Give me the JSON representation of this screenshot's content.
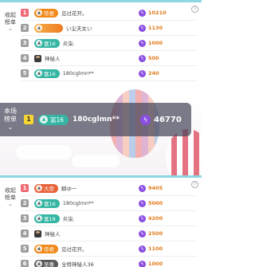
{
  "top_board": {
    "side_label_line1": "收起",
    "side_label_line2": "榜单",
    "chevron": "⌃",
    "rows": [
      {
        "rank": "1",
        "badge": "帝君",
        "badge_color": "orange",
        "name": "见过花开。",
        "score": "10210",
        "avatar": false
      },
      {
        "rank": "2",
        "badge": "",
        "badge_color": "flame",
        "name": "い尘夫女い",
        "score": "1130",
        "avatar": false
      },
      {
        "rank": "3",
        "badge": "富16",
        "badge_color": "teal",
        "name": "炎柒.",
        "score": "1000",
        "avatar": false
      },
      {
        "rank": "4",
        "badge": "",
        "badge_color": "",
        "name": "神秘人",
        "score": "500",
        "avatar": true
      },
      {
        "rank": "5",
        "badge": "富16",
        "badge_color": "teal",
        "name": "180cglmn**",
        "score": "240",
        "avatar": false
      }
    ]
  },
  "live_banner": {
    "title_line1": "本场",
    "title_line2": "榜单",
    "chevron": "⌄",
    "rank": "1",
    "badge": "富16",
    "name": "180cglmn**",
    "score": "46770"
  },
  "bottom_board": {
    "side_label_line1": "收起",
    "side_label_line2": "榜单",
    "chevron": "⌃",
    "rows": [
      {
        "rank": "1",
        "badge": "大帝",
        "badge_color": "red",
        "name": "瞬ゆ一",
        "score": "9405",
        "avatar": false
      },
      {
        "rank": "2",
        "badge": "富16",
        "badge_color": "teal",
        "name": "180cglmn**",
        "score": "5000",
        "avatar": false
      },
      {
        "rank": "3",
        "badge": "富18",
        "badge_color": "teal",
        "name": "炎柒.",
        "score": "4200",
        "avatar": false
      },
      {
        "rank": "4",
        "badge": "",
        "badge_color": "",
        "name": "神秘人",
        "score": "2500",
        "avatar": true
      },
      {
        "rank": "5",
        "badge": "帝君",
        "badge_color": "orange",
        "name": "见过花开。",
        "score": "1100",
        "avatar": false
      },
      {
        "rank": "6",
        "badge": "至尊",
        "badge_color": "dark",
        "name": "全特神秘人36",
        "score": "1000",
        "avatar": false
      }
    ]
  },
  "icons": {
    "coin": "lightning-coin-icon",
    "help": "help-icon"
  },
  "colors": {
    "accent_teal": "#35b6a3",
    "rank_first": "#f06a76",
    "score_orange": "#e07a1a",
    "coin_purple": "#8a4ee0"
  }
}
